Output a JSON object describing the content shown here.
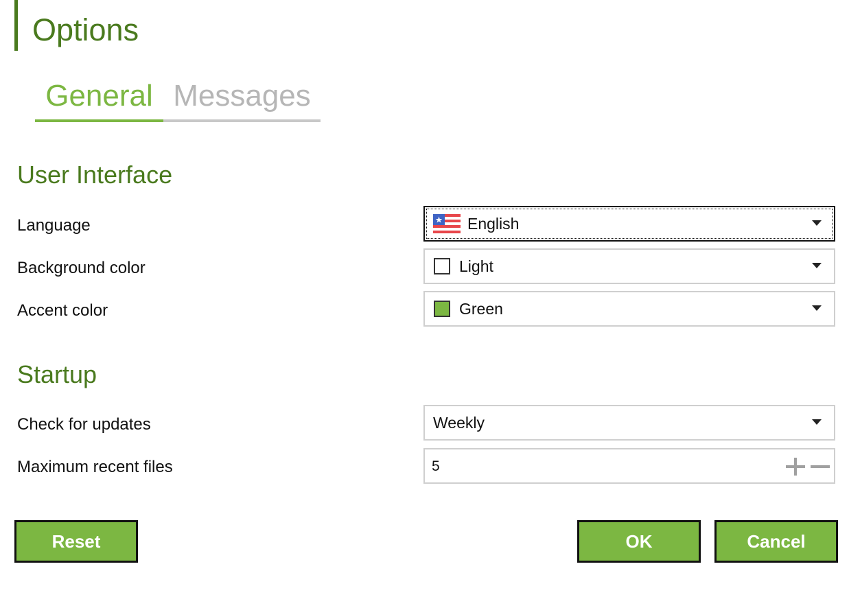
{
  "window": {
    "title": "Options"
  },
  "tabs": [
    {
      "label": "General",
      "active": true
    },
    {
      "label": "Messages",
      "active": false
    }
  ],
  "sections": {
    "user_interface": {
      "title": "User Interface",
      "language": {
        "label": "Language",
        "value": "English",
        "icon": "us-flag-icon"
      },
      "background_color": {
        "label": "Background color",
        "value": "Light",
        "swatch_color": "#ffffff"
      },
      "accent_color": {
        "label": "Accent color",
        "value": "Green",
        "swatch_color": "#7cb742"
      }
    },
    "startup": {
      "title": "Startup",
      "check_updates": {
        "label": "Check for updates",
        "value": "Weekly"
      },
      "max_recent_files": {
        "label": "Maximum recent files",
        "value": "5"
      }
    }
  },
  "buttons": {
    "reset": "Reset",
    "ok": "OK",
    "cancel": "Cancel"
  },
  "colors": {
    "heading": "#4a7a1e",
    "accent": "#7cb742",
    "tab_inactive": "#b6b6b6",
    "border": "#cfcfcf"
  }
}
